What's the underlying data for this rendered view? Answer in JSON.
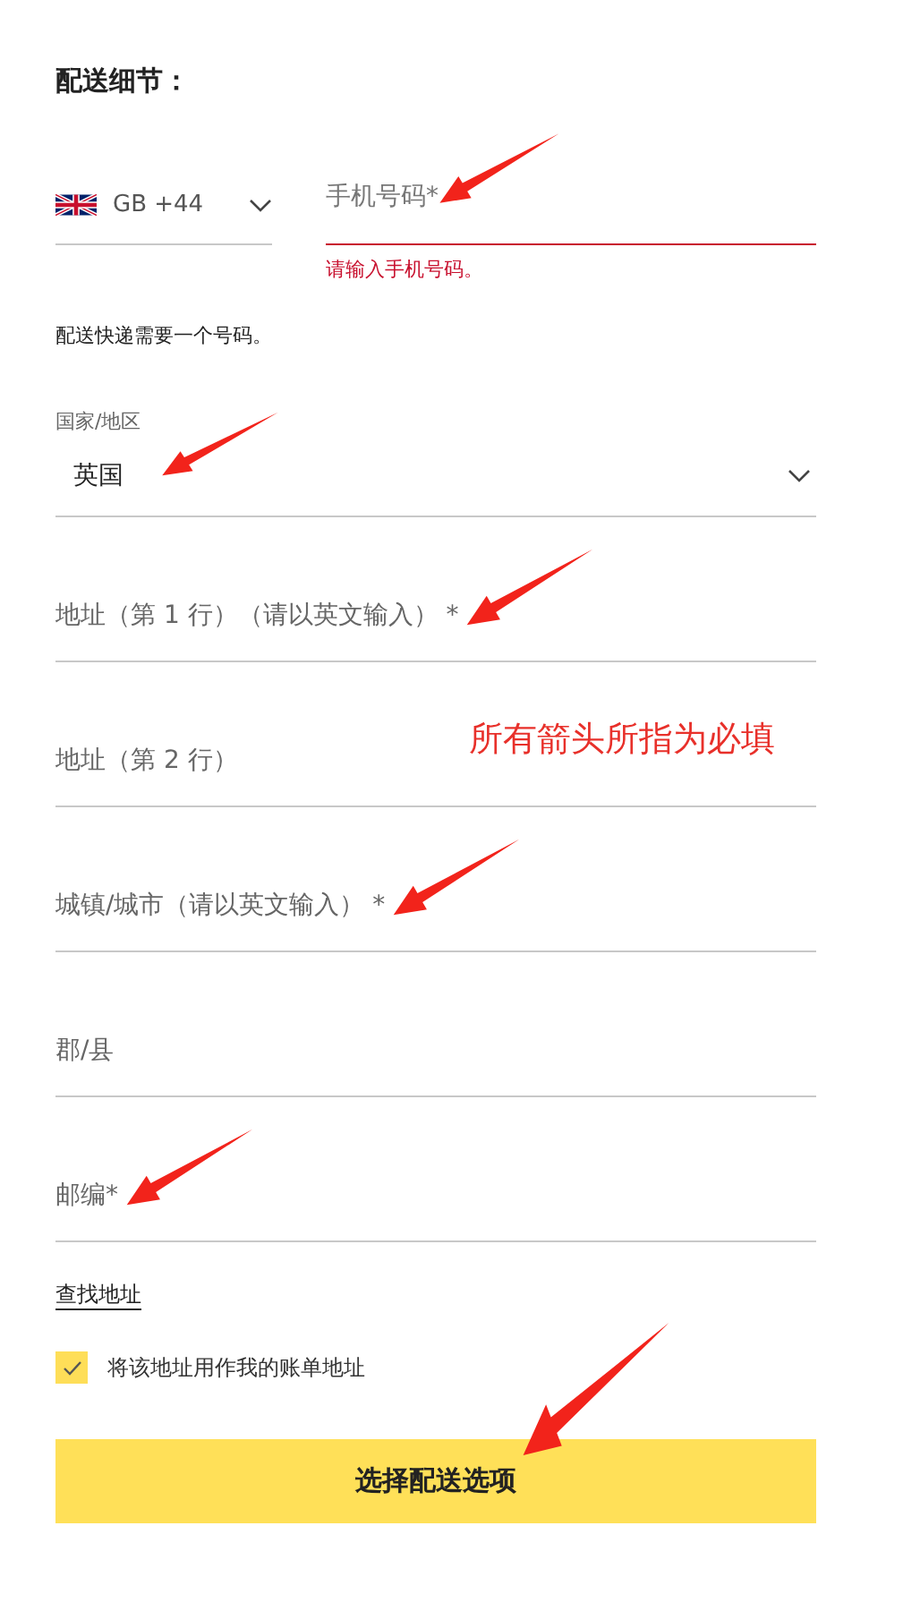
{
  "heading": "配送细节：",
  "phone": {
    "country_code": "GB +44",
    "placeholder": "手机号码*",
    "error": "请输入手机号码。",
    "arrow": true
  },
  "phone_hint": "配送快递需要一个号码。",
  "country": {
    "label": "国家/地区",
    "value": "英国",
    "arrow": true
  },
  "fields": [
    {
      "placeholder": "地址（第 1 行）（请以英文输入） *",
      "arrow": true
    },
    {
      "placeholder": "地址（第 2 行）",
      "arrow": false,
      "note": "所有箭头所指为必填"
    },
    {
      "placeholder": "城镇/城市（请以英文输入） *",
      "arrow": true
    },
    {
      "placeholder": "郡/县",
      "arrow": false
    },
    {
      "placeholder": "邮编*",
      "arrow": true
    }
  ],
  "find_address_link": "查找地址",
  "billing_checkbox": {
    "label": "将该地址用作我的账单地址",
    "checked": true
  },
  "submit_button": {
    "label": "选择配送选项",
    "arrow": true
  }
}
